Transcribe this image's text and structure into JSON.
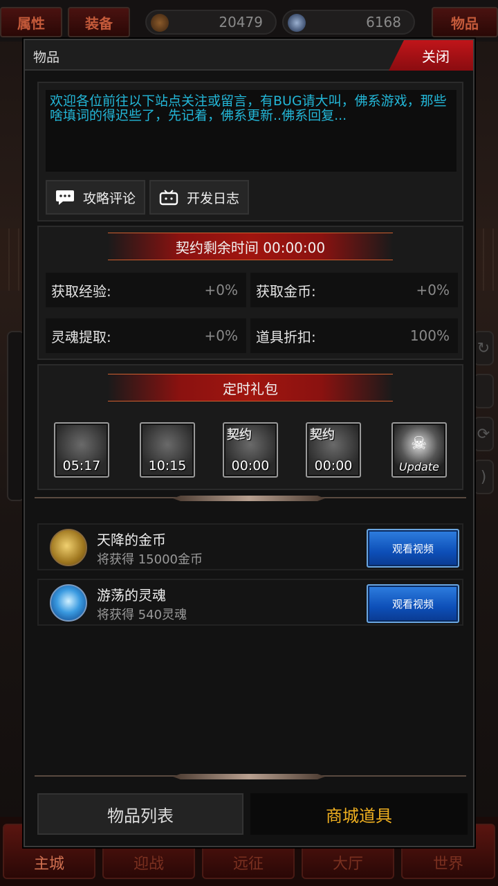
{
  "topbar": {
    "attr_label": "属性",
    "equip_label": "装备",
    "gold_value": "20479",
    "soul_value": "6168",
    "items_label": "物品"
  },
  "modal": {
    "title": "物品",
    "close_label": "关闭",
    "notice": "欢迎各位前往以下站点关注或留言，有BUG请大叫，佛系游戏，那些啥填词的得迟些了，先记着，佛系更新..佛系回复...",
    "link_buttons": [
      {
        "label": "攻略评论",
        "icon": "chat-bubble-icon"
      },
      {
        "label": "开发日志",
        "icon": "tv-icon"
      }
    ],
    "contract": {
      "banner": "契约剩余时间 00:00:00",
      "stats": [
        {
          "label": "获取经验:",
          "value": "+0%"
        },
        {
          "label": "获取金币:",
          "value": "+0%"
        },
        {
          "label": "灵魂提取:",
          "value": "+0%"
        },
        {
          "label": "道具折扣:",
          "value": "100%"
        }
      ]
    },
    "timed_gifts": {
      "banner": "定时礼包",
      "items": [
        {
          "tag": "",
          "time": "05:17",
          "icon": "treasure-chest-icon"
        },
        {
          "tag": "",
          "time": "10:15",
          "icon": "treasure-chest-icon"
        },
        {
          "tag": "契约",
          "time": "00:00",
          "icon": "contract-chest-icon"
        },
        {
          "tag": "契约",
          "time": "00:00",
          "icon": "contract-chest-icon"
        },
        {
          "tag": "",
          "time": "Update",
          "icon": "skull-update-icon"
        }
      ]
    },
    "rewards": [
      {
        "title": "天降的金币",
        "sub": "将获得 15000金币",
        "button": "观看视频",
        "icon": "gold-coins-icon"
      },
      {
        "title": "游荡的灵魂",
        "sub": "将获得 540灵魂",
        "button": "观看视频",
        "icon": "blue-soul-icon"
      }
    ],
    "tabs": [
      {
        "label": "物品列表",
        "active": false
      },
      {
        "label": "商城道具",
        "active": true
      }
    ]
  },
  "bottom_nav": [
    "主城",
    "迎战",
    "远征",
    "大厅",
    "世界"
  ],
  "colors": {
    "accent_red": "#c0151a",
    "notice_text": "#23b7d8",
    "tab_active": "#f0b020",
    "watch_button": "#0d4fb8"
  }
}
